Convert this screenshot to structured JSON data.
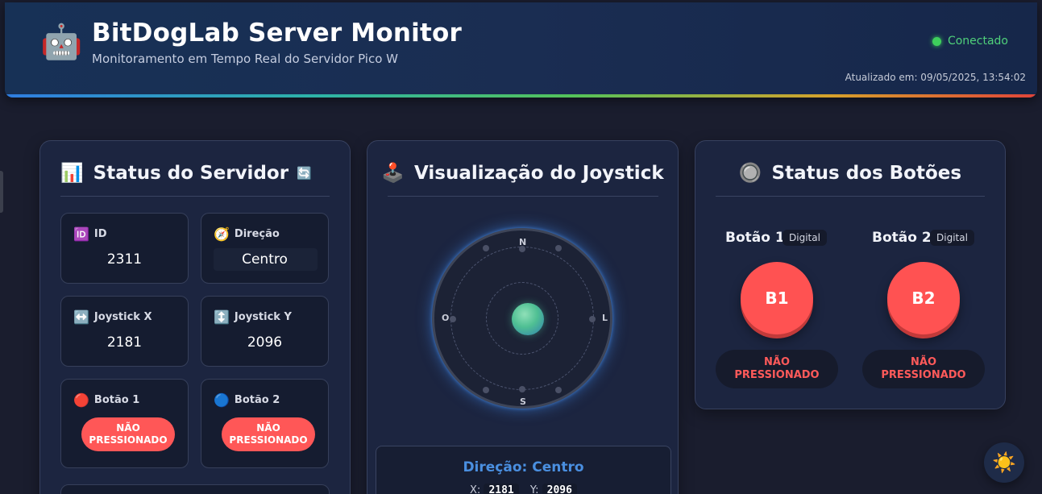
{
  "header": {
    "logo_icon": "🤖",
    "title": "BitDogLab Server Monitor",
    "subtitle": "Monitoramento em Tempo Real do Servidor Pico W",
    "connection_status": "Conectado",
    "updated_at": "Atualizado em: 09/05/2025, 13:54:02"
  },
  "server_status": {
    "icon": "📊",
    "title": "Status do Servidor",
    "refresh_icon": "🔄",
    "id": {
      "icon": "🆔",
      "label": "ID",
      "value": "2311"
    },
    "direction": {
      "icon": "🧭",
      "label": "Direção",
      "value": "Centro"
    },
    "joystick_x": {
      "icon": "↔️",
      "label": "Joystick X",
      "value": "2181"
    },
    "joystick_y": {
      "icon": "↕️",
      "label": "Joystick Y",
      "value": "2096"
    },
    "button1": {
      "icon": "🔴",
      "label": "Botão 1",
      "state_line1": "NÃO",
      "state_line2": "PRESSIONADO"
    },
    "button2": {
      "icon": "🔵",
      "label": "Botão 2",
      "state_line1": "NÃO",
      "state_line2": "PRESSIONADO"
    }
  },
  "joystick_view": {
    "icon": "🕹️",
    "title": "Visualização do Joystick",
    "north": "N",
    "south": "S",
    "east": "L",
    "west": "O",
    "direction_text": "Direção: Centro",
    "x_label": "X:",
    "x_value": "2181",
    "y_label": "Y:",
    "y_value": "2096"
  },
  "buttons_status": {
    "icon": "🔘",
    "title": "Status dos Botões",
    "buttons": [
      {
        "name": "Botão 1",
        "badge": "Digital",
        "face": "B1",
        "state_line1": "NÃO",
        "state_line2": "PRESSIONADO"
      },
      {
        "name": "Botão 2",
        "badge": "Digital",
        "face": "B2",
        "state_line1": "NÃO",
        "state_line2": "PRESSIONADO"
      }
    ]
  },
  "theme_toggle": {
    "icon": "☀️"
  },
  "colors": {
    "accent_red": "#ff5757",
    "connected_green": "#3ecf5c",
    "direction_blue": "#4a8fe0"
  }
}
